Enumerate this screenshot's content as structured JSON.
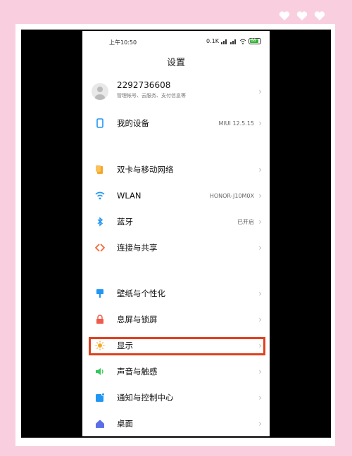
{
  "status_bar": {
    "time": "上午10:50",
    "indicators": "0.1K",
    "battery_level": "68"
  },
  "page_title": "设置",
  "account": {
    "id": "2292736608",
    "subtitle": "管理帐号、云服务、支付信息等"
  },
  "rows": {
    "my_device": {
      "label": "我的设备",
      "value": "MIUI 12.5.15"
    },
    "dual_sim": {
      "label": "双卡与移动网络"
    },
    "wlan": {
      "label": "WLAN",
      "value": "HONOR-J10M0X"
    },
    "bluetooth": {
      "label": "蓝牙",
      "value": "已开启"
    },
    "connect_share": {
      "label": "连接与共享"
    },
    "wallpaper": {
      "label": "壁纸与个性化"
    },
    "lock_screen": {
      "label": "息屏与锁屏"
    },
    "display": {
      "label": "显示"
    },
    "sound": {
      "label": "声音与触感"
    },
    "notifications": {
      "label": "通知与控制中心"
    },
    "desktop": {
      "label": "桌面"
    }
  },
  "chevron": "›",
  "colors": {
    "background": "#f9cfe0",
    "highlight": "#e0401f",
    "accent_blue": "#2196f3",
    "accent_orange": "#f5a623"
  }
}
